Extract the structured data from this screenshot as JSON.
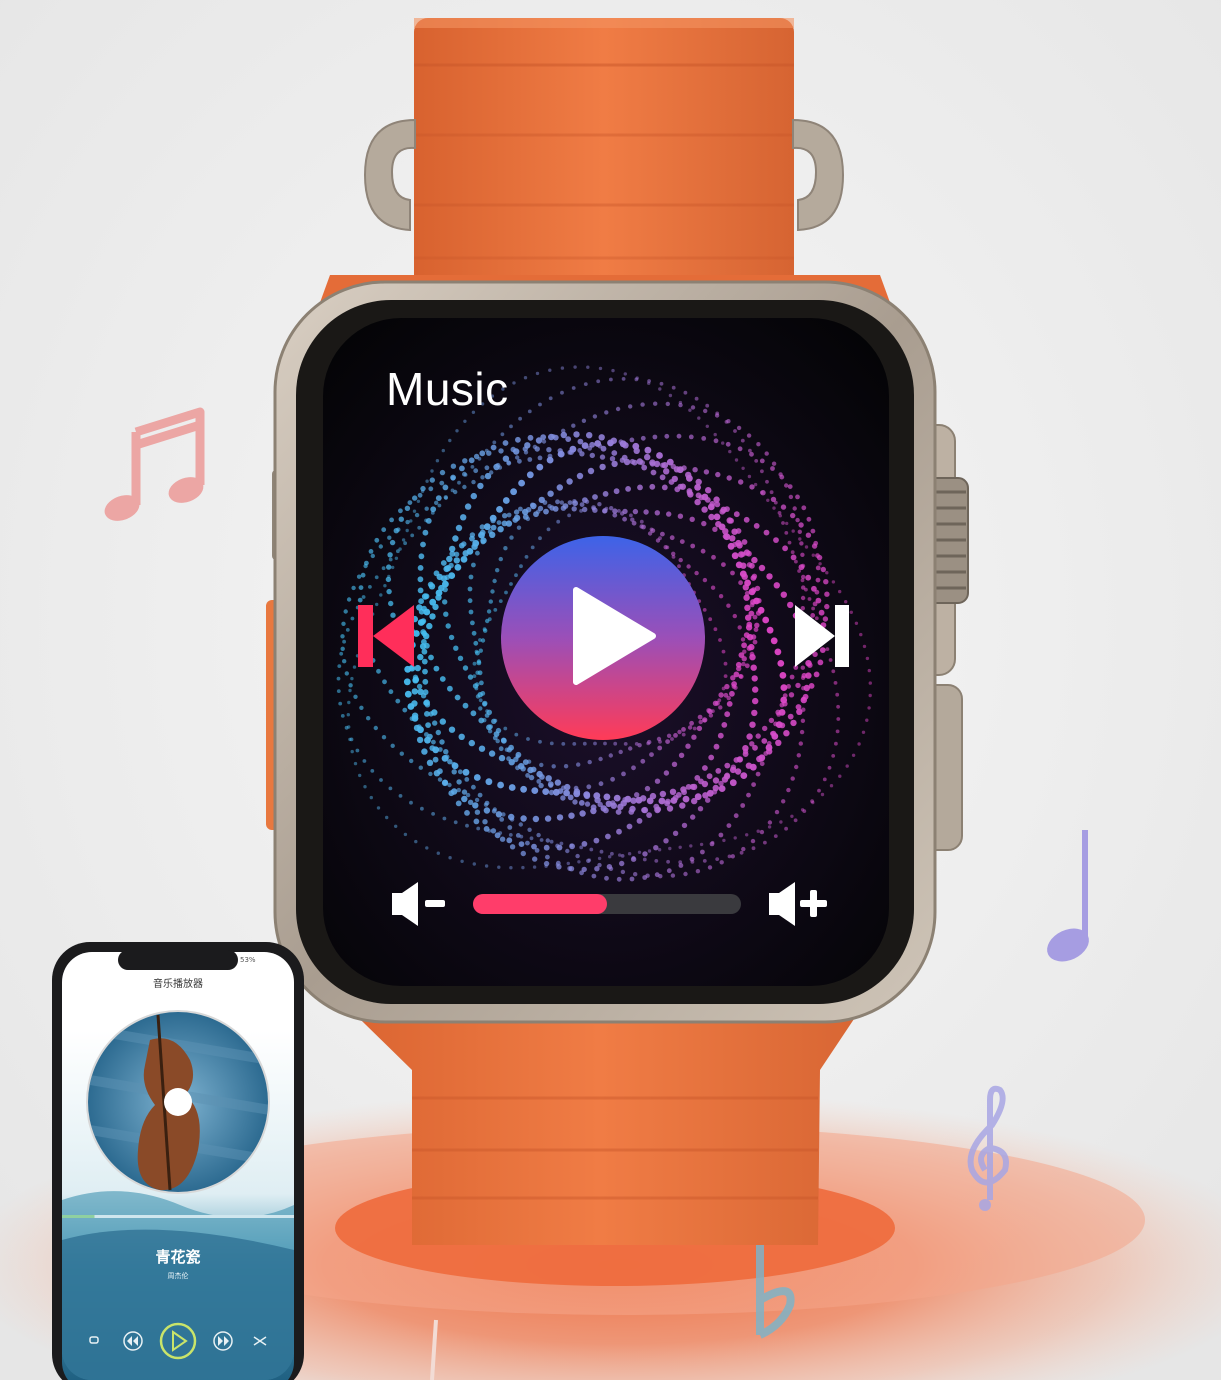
{
  "watch": {
    "title": "Music",
    "volume_level": 0.5,
    "colors": {
      "band": "#ec7a45",
      "case": "#b8ada1",
      "screen": "#050507",
      "progress_fill": "#ff3d6a",
      "progress_track": "#3a3a3e",
      "play_gradient_top": "#3d63e8",
      "play_gradient_bottom": "#ff3b57"
    },
    "icons": {
      "previous": "skip-previous-icon",
      "play": "play-icon",
      "next": "skip-next-icon",
      "volume_down": "volume-down-icon",
      "volume_up": "volume-up-icon"
    }
  },
  "phone": {
    "app_title": "音乐播放器",
    "battery": "53%",
    "song_title": "青花瓷",
    "artist": "周杰伦",
    "playback_progress": 0.14,
    "controls": [
      "repeat-icon",
      "rewind-icon",
      "play-icon",
      "fast-forward-icon",
      "shuffle-icon"
    ]
  },
  "decorations": [
    "music-note-icon",
    "quarter-note-icon",
    "treble-clef-icon",
    "flat-sign-icon"
  ]
}
